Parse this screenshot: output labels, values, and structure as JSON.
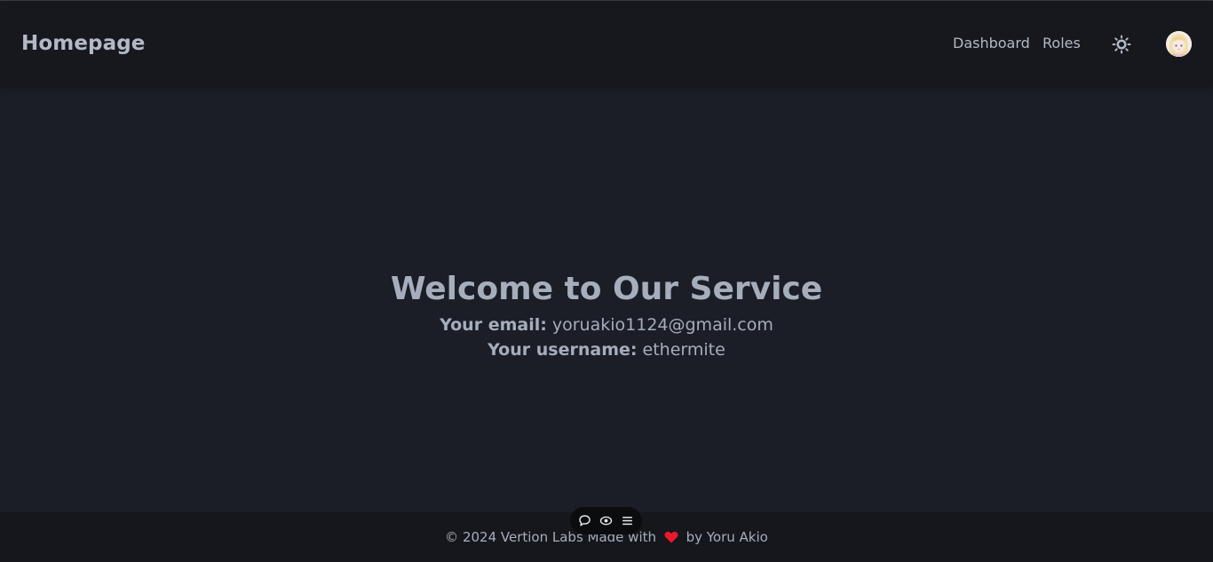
{
  "navbar": {
    "brand": "Homepage",
    "links": [
      {
        "label": "Dashboard"
      },
      {
        "label": "Roles"
      }
    ],
    "theme_toggle_icon": "sun-icon",
    "avatar_icon": "user-avatar"
  },
  "main": {
    "title": "Welcome to Our Service",
    "email_label": "Your email:",
    "email_value": "yoruakio1124@gmail.com",
    "username_label": "Your username:",
    "username_value": "ethermite"
  },
  "footer": {
    "text_before": "© 2024 Vertion Labs Made with",
    "heart_icon": "heart-icon",
    "heart_color": "#e8192c",
    "text_after": "by Yoru Akio"
  },
  "toolbar": {
    "icons": [
      "chat-icon",
      "eye-icon",
      "menu-icon"
    ]
  },
  "colors": {
    "background": "#1b1e26",
    "navbar": "#16181d",
    "text": "#a6adbb"
  }
}
